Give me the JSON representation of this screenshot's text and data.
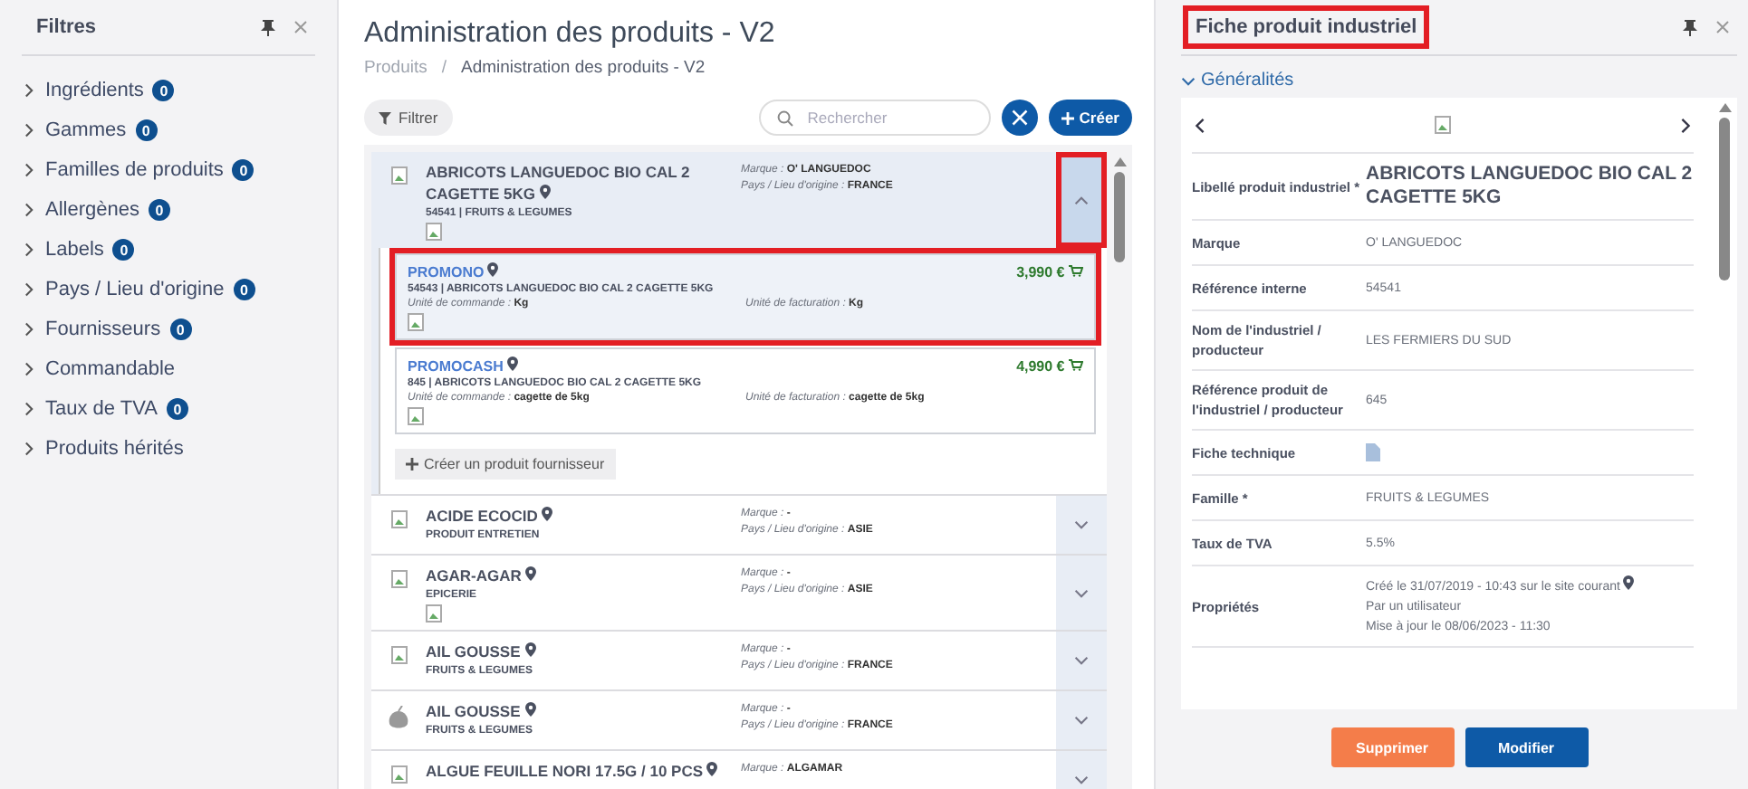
{
  "sidebar": {
    "title": "Filtres",
    "items": [
      {
        "label": "Ingrédients",
        "count": "0"
      },
      {
        "label": "Gammes",
        "count": "0"
      },
      {
        "label": "Familles de produits",
        "count": "0"
      },
      {
        "label": "Allergènes",
        "count": "0"
      },
      {
        "label": "Labels",
        "count": "0"
      },
      {
        "label": "Pays / Lieu d'origine",
        "count": "0"
      },
      {
        "label": "Fournisseurs",
        "count": "0"
      },
      {
        "label": "Commandable"
      },
      {
        "label": "Taux de TVA",
        "count": "0"
      },
      {
        "label": "Produits hérités"
      }
    ]
  },
  "main": {
    "title": "Administration des produits - V2",
    "breadcrumb": [
      "Produits",
      "Administration des produits - V2"
    ],
    "breadcrumb_separator": "/",
    "filter_button": "Filtrer",
    "search": {
      "placeholder": "Rechercher"
    },
    "create_button": "Créer",
    "products": [
      {
        "name": "ABRICOTS LANGUEDOC BIO CAL 2 CAGETTE 5KG",
        "info": "54541 | FRUITS & LEGUMES",
        "kind": "broken",
        "extra_image": true,
        "marque_label": "Marque :",
        "marque": "O' LANGUEDOC",
        "origin_label": "Pays / Lieu d'origine :",
        "origin": "FRANCE",
        "expanded": true,
        "highlighted": true,
        "suppliers": [
          {
            "name": "PROMONO",
            "info": "54543 | ABRICOTS LANGUEDOC BIO CAL 2 CAGETTE 5KG",
            "price": "3,990 €",
            "order_label": "Unité de commande :",
            "order_unit": "Kg",
            "billing_label": "Unité de facturation :",
            "billing_unit": "Kg",
            "highlighted": true
          },
          {
            "name": "PROMOCASH",
            "info": "845 | ABRICOTS LANGUEDOC BIO CAL 2 CAGETTE 5KG",
            "price": "4,990 €",
            "order_label": "Unité de commande :",
            "order_unit": "cagette de 5kg",
            "billing_label": "Unité de facturation :",
            "billing_unit": "cagette de 5kg",
            "highlighted": false
          }
        ],
        "create_supplier": "Créer un produit fournisseur"
      },
      {
        "name": "ACIDE ECOCID",
        "info": "PRODUIT ENTRETIEN",
        "kind": "broken",
        "extra_image": false,
        "marque_label": "Marque :",
        "marque": "-",
        "origin_label": "Pays / Lieu d'origine :",
        "origin": "ASIE",
        "expanded": false,
        "highlighted": false
      },
      {
        "name": "AGAR-AGAR",
        "info": "EPICERIE",
        "kind": "broken",
        "extra_image": true,
        "marque_label": "Marque :",
        "marque": "-",
        "origin_label": "Pays / Lieu d'origine :",
        "origin": "ASIE",
        "expanded": false,
        "highlighted": false
      },
      {
        "name": "AIL GOUSSE",
        "info": "FRUITS & LEGUMES",
        "kind": "broken",
        "extra_image": false,
        "marque_label": "Marque :",
        "marque": "-",
        "origin_label": "Pays / Lieu d'origine :",
        "origin": "FRANCE",
        "expanded": false,
        "highlighted": false
      },
      {
        "name": "AIL GOUSSE",
        "info": "FRUITS & LEGUMES",
        "kind": "fruit",
        "extra_image": false,
        "marque_label": "Marque :",
        "marque": "-",
        "origin_label": "Pays / Lieu d'origine :",
        "origin": "FRANCE",
        "expanded": false,
        "highlighted": false
      },
      {
        "name": "ALGUE FEUILLE NORI 17.5G / 10 PCS",
        "kind": "broken",
        "extra_image": false,
        "marque_label": "Marque :",
        "marque": "ALGAMAR",
        "expanded": false,
        "highlighted": false
      }
    ]
  },
  "detail": {
    "title": "Fiche produit industriel",
    "title_highlighted": true,
    "section": {
      "label": "Généralités",
      "expanded": true
    },
    "fields": [
      {
        "kind": "title",
        "label": "Libellé produit industriel *",
        "value": "ABRICOTS LANGUEDOC BIO CAL 2 CAGETTE 5KG"
      },
      {
        "kind": "text",
        "label": "Marque",
        "value": "O' LANGUEDOC"
      },
      {
        "kind": "text",
        "label": "Référence interne",
        "value": "54541"
      },
      {
        "kind": "text",
        "label": "Nom de l'industriel / producteur",
        "value": "LES FERMIERS DU SUD"
      },
      {
        "kind": "text",
        "label": "Référence produit de l'industriel / producteur",
        "value": "645"
      },
      {
        "kind": "file",
        "label": "Fiche technique"
      },
      {
        "kind": "text",
        "label": "Famille *",
        "value": "FRUITS & LEGUMES"
      },
      {
        "kind": "text",
        "label": "Taux de TVA",
        "value": "5.5%"
      },
      {
        "kind": "lines",
        "label": "Propriétés",
        "lines": [
          "Créé le 31/07/2019 - 10:43 sur le site courant",
          "Par un utilisateur",
          "Mise à jour le 08/06/2023 - 11:30"
        ]
      }
    ],
    "buttons": [
      {
        "label": "Supprimer",
        "kind": "danger"
      },
      {
        "label": "Modifier",
        "kind": "primary"
      }
    ]
  }
}
